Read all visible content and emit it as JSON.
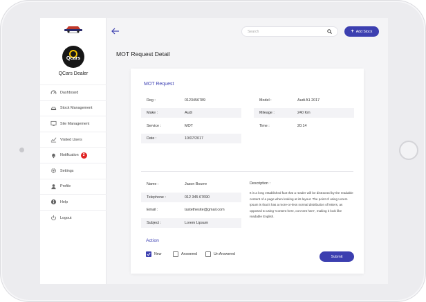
{
  "sidebar": {
    "dealer_name": "QCars Dealer",
    "brand_text": "Qcars",
    "items": [
      {
        "label": "Dashboard",
        "icon": "speedometer-icon"
      },
      {
        "label": "Stock Management",
        "icon": "car-icon"
      },
      {
        "label": "Site Management",
        "icon": "monitor-icon"
      },
      {
        "label": "Visited Users",
        "icon": "chart-icon"
      },
      {
        "label": "Notification",
        "icon": "bell-icon",
        "badge": "2"
      },
      {
        "label": "Settings",
        "icon": "gear-icon"
      },
      {
        "label": "Profile",
        "icon": "user-icon"
      },
      {
        "label": "Help",
        "icon": "info-icon"
      },
      {
        "label": "Logout",
        "icon": "power-icon"
      }
    ]
  },
  "header": {
    "search_placeholder": "Search",
    "add_stock_label": "Add Stock"
  },
  "page_title": "MOT Request Detail",
  "mot": {
    "section_title": "MOT Request",
    "left": [
      {
        "label": "Reg :",
        "value": "0123456789"
      },
      {
        "label": "Make :",
        "value": "Audi"
      },
      {
        "label": "Service :",
        "value": "MOT"
      },
      {
        "label": "Date :",
        "value": "10/07/2017"
      }
    ],
    "right": [
      {
        "label": "Model :",
        "value": "Audi A1 2017"
      },
      {
        "label": "Mileage :",
        "value": "240 Km"
      },
      {
        "label": "Time :",
        "value": "20:14"
      }
    ]
  },
  "customer": {
    "fields": [
      {
        "label": "Name :",
        "value": "Jason Bourre"
      },
      {
        "label": "Telephone :",
        "value": "012 345 67690"
      },
      {
        "label": "Email :",
        "value": "tastethesite@gmail.com"
      },
      {
        "label": "Subject :",
        "value": "Lorem Lipsum"
      }
    ],
    "description_label": "Description :",
    "description": "It is a long established fact that a reader will be distracted by the readable content of a page when looking at its layout. The point of using Lorem Ipsum is that it has a more-or-less normal distribution of letters, as opposed to using 'Content here, con-tent here', making it look like readable English."
  },
  "action": {
    "title": "Action",
    "options": [
      {
        "label": "New",
        "checked": true
      },
      {
        "label": "Answered",
        "checked": false
      },
      {
        "label": "Un Answered",
        "checked": false
      }
    ],
    "submit_label": "Submit"
  },
  "colors": {
    "accent": "#3c3fb0",
    "badge": "#e02424",
    "brand_yellow": "#f5c400"
  }
}
